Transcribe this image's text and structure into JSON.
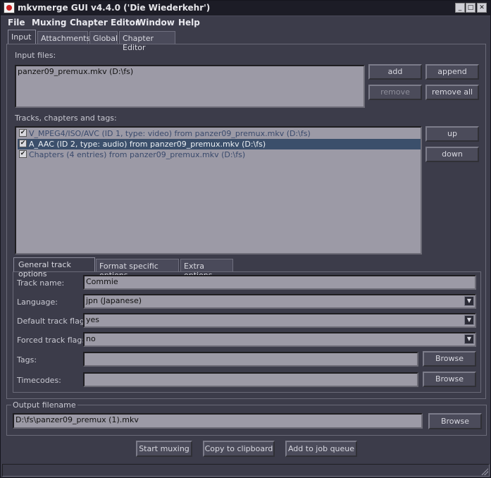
{
  "window": {
    "title": "mkvmerge GUI v4.4.0 ('Die Wiederkehr')"
  },
  "menu": [
    "File",
    "Muxing",
    "Chapter Editor",
    "Window",
    "Help"
  ],
  "main_tabs": [
    "Input",
    "Attachments",
    "Global",
    "Chapter Editor"
  ],
  "input_files": {
    "label": "Input files:",
    "files": [
      "panzer09_premux.mkv (D:\\fs)"
    ],
    "buttons": {
      "add": "add",
      "append": "append",
      "remove": "remove",
      "remove_all": "remove all"
    }
  },
  "tracks": {
    "label": "Tracks, chapters and tags:",
    "items": [
      {
        "text": "V_MPEG4/ISO/AVC (ID 1, type: video) from panzer09_premux.mkv (D:\\fs)",
        "checked": true,
        "selected": false
      },
      {
        "text": "A_AAC (ID 2, type: audio) from panzer09_premux.mkv (D:\\fs)",
        "checked": true,
        "selected": true
      },
      {
        "text": "Chapters (4 entries) from panzer09_premux.mkv (D:\\fs)",
        "checked": true,
        "selected": false
      }
    ],
    "buttons": {
      "up": "up",
      "down": "down"
    }
  },
  "track_tabs": [
    "General track options",
    "Format specific options",
    "Extra options"
  ],
  "track_options": {
    "track_name_label": "Track name:",
    "track_name_value": "Commie",
    "language_label": "Language:",
    "language_value": "jpn (Japanese)",
    "default_flag_label": "Default track flag:",
    "default_flag_value": "yes",
    "forced_flag_label": "Forced track flag:",
    "forced_flag_value": "no",
    "tags_label": "Tags:",
    "tags_value": "",
    "timecodes_label": "Timecodes:",
    "timecodes_value": "",
    "browse": "Browse"
  },
  "output": {
    "label": "Output filename",
    "value": "D:\\fs\\panzer09_premux (1).mkv",
    "browse": "Browse"
  },
  "actions": {
    "start": "Start muxing",
    "copy": "Copy to clipboard",
    "queue": "Add to job queue"
  },
  "colors": {
    "background": "#3c3c4a",
    "field": "#9c9aa6",
    "selection": "#3b4f6b"
  }
}
